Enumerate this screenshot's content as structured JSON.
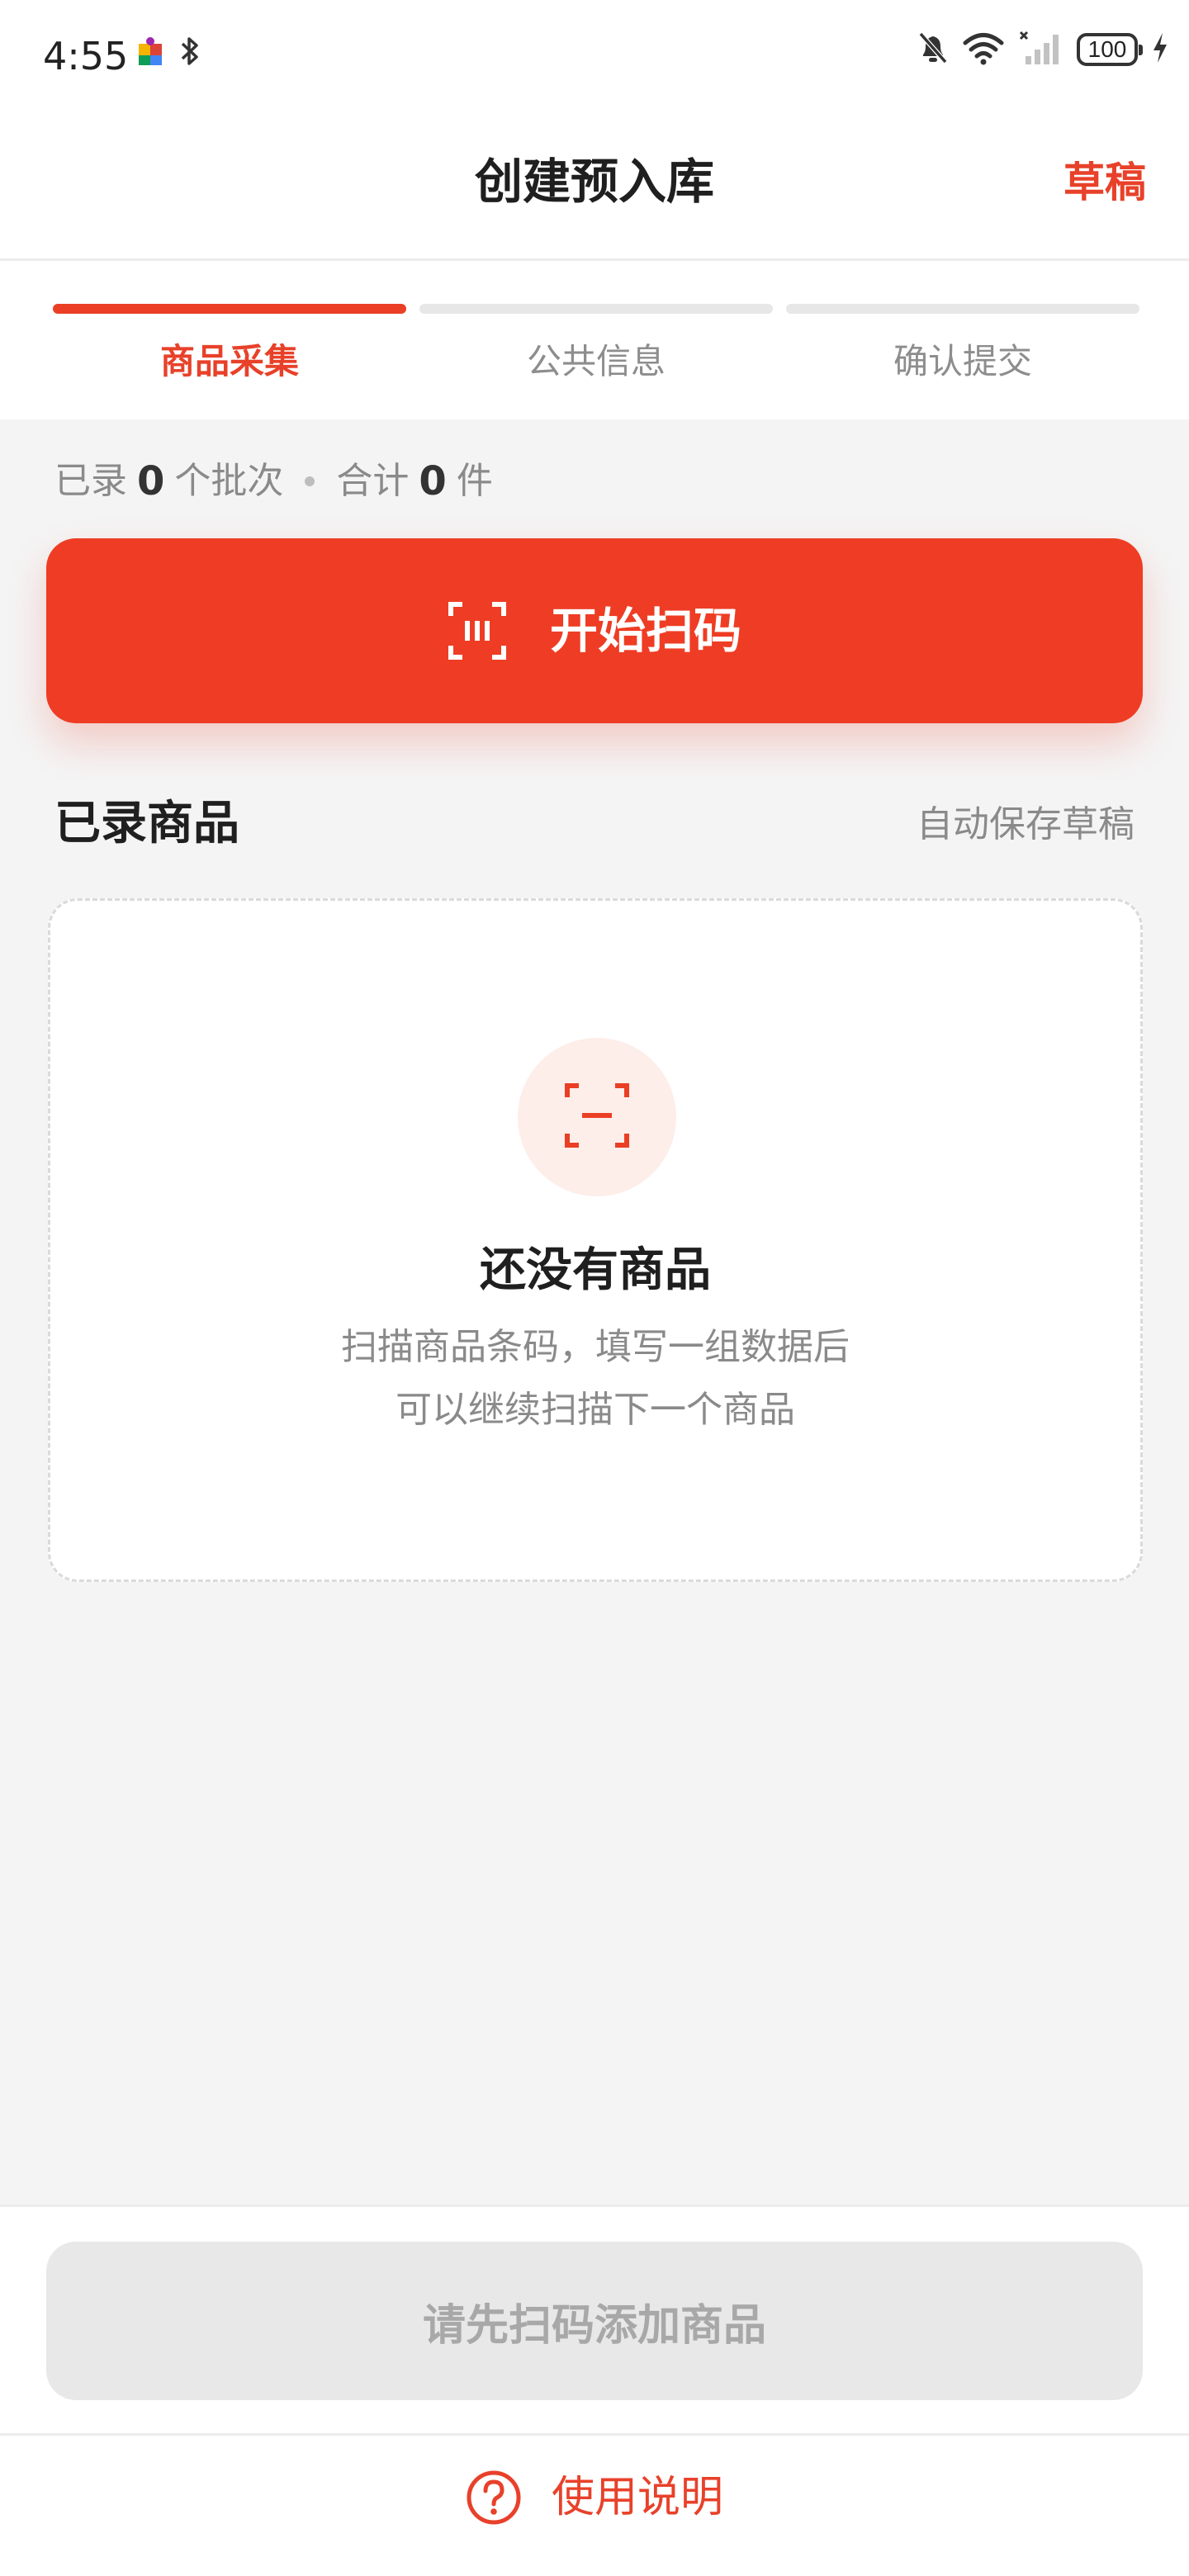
{
  "status_bar": {
    "time": "4:55",
    "battery": "100",
    "icons": [
      "puzzle-icon",
      "bluetooth-icon",
      "muted-bell-icon",
      "wifi-icon",
      "no-signal-icon",
      "battery-icon",
      "charging-icon"
    ]
  },
  "header": {
    "title": "创建预入库",
    "draft_label": "草稿"
  },
  "steps": [
    {
      "label": "商品采集",
      "active": true
    },
    {
      "label": "公共信息",
      "active": false
    },
    {
      "label": "确认提交",
      "active": false
    }
  ],
  "summary": {
    "prefix": "已录",
    "batches": "0",
    "batch_unit": "个批次",
    "total_label": "合计",
    "items": "0",
    "item_unit": "件"
  },
  "scan_button": {
    "label": "开始扫码",
    "icon": "barcode-scan-icon"
  },
  "section": {
    "title": "已录商品",
    "hint": "自动保存草稿"
  },
  "empty_state": {
    "icon": "scan-frame-icon",
    "title": "还没有商品",
    "line1": "扫描商品条码，填写一组数据后",
    "line2": "可以继续扫描下一个商品"
  },
  "footer": {
    "submit_label": "请先扫码添加商品",
    "help_label": "使用说明",
    "help_icon": "question-circle-icon"
  },
  "colors": {
    "accent": "#ee3d24",
    "accent_text": "#e8412a",
    "muted_text": "#8a8a8a",
    "disabled_bg": "#e8e8e8",
    "disabled_text": "#a8a8a8",
    "page_bg": "#f4f4f4"
  }
}
